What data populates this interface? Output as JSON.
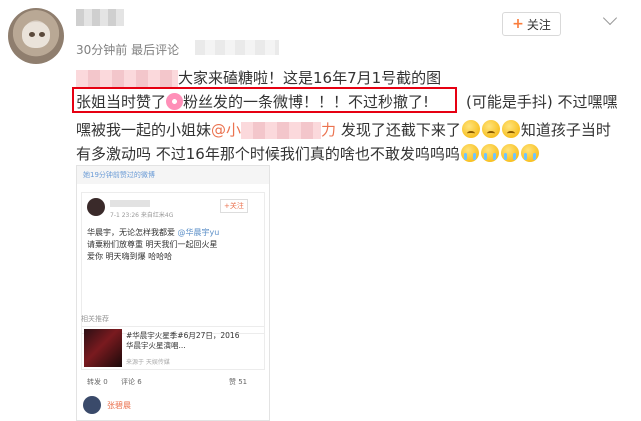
{
  "user": {
    "meta": "30分钟前 最后评论"
  },
  "follow_button": {
    "plus": "+",
    "label": "关注"
  },
  "post": {
    "line1_text": "大家来磕糖啦！这是16年7月1号截的图",
    "line2_a": "张姐当时赞了",
    "line2_b": "粉丝发的一条微博！！！不过秒撤了!",
    "line2_c": "(可能是手抖) 不过嘿嘿",
    "line3_a": "嘿被我一起的小姐妹",
    "line3_mention": "@小",
    "line3_mention_end": "力",
    "line3_b": "发现了还截下来了",
    "line3_c": "知道孩子当时",
    "line4": "有多激动吗 不过16年那个时候我们真的啥也不敢发呜呜呜"
  },
  "embedded": {
    "top_bar": "她19分钟前赞过的微博",
    "post_time": "7-1 23:26 来自红米4G",
    "follow": "+关注",
    "text_line1_a": "华晨宇，无论怎样我都爱",
    "text_line1_b": "@华晨宇yu",
    "text_line2": "请粟粉们放尊重 明天我们一起回火星",
    "text_line3": "爱你 明天嗨到爆 哈哈哈",
    "related_label": "相关推荐",
    "rec_title": "#华晨宇火星季#6月27日，2016华晨宇火星演唱...",
    "rec_source": "来源于 天娱传媒",
    "actions_repost": "转发 0",
    "actions_comment": "评论 6",
    "actions_like": "赞 51",
    "commenter_name": "张碧晨"
  },
  "colors": {
    "highlight_border": "#e60012",
    "mention": "#eb7350",
    "follow_plus": "#fa7d3c"
  }
}
